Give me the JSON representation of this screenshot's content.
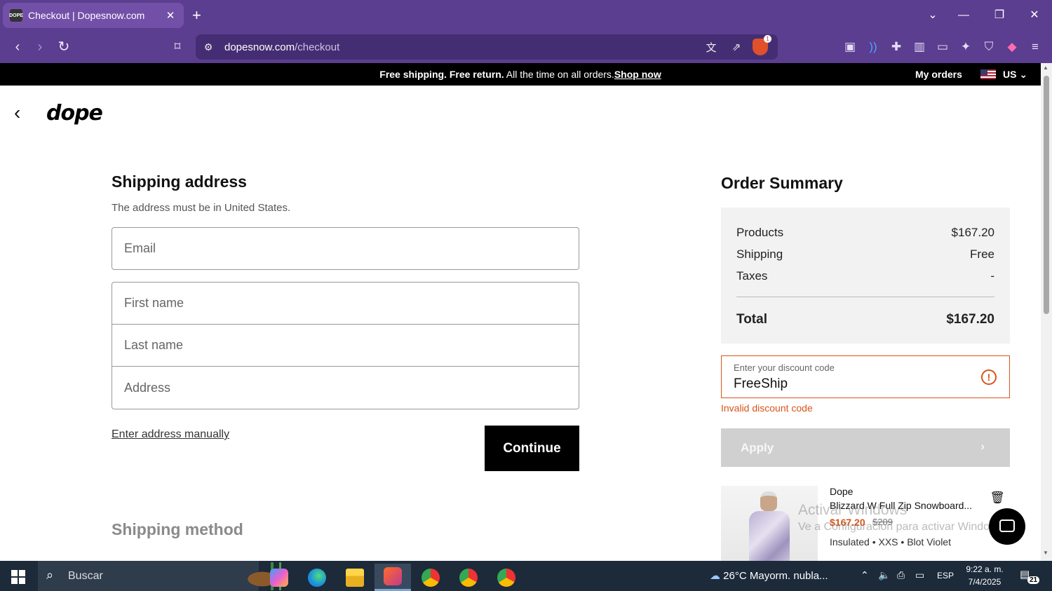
{
  "browser": {
    "tab_title": "Checkout | Dopesnow.com",
    "tab_favicon": "DOPE",
    "url_domain": "dopesnow.com",
    "url_path": "/checkout"
  },
  "promo": {
    "text": "Free shipping. Free return.",
    "text_rest": " All the time on all orders.",
    "link": "Shop now",
    "my_orders": "My orders",
    "country": "US"
  },
  "header": {
    "logo": "dope"
  },
  "shipping": {
    "title": "Shipping address",
    "subtitle": "The address must be in United States.",
    "email_placeholder": "Email",
    "first_name_placeholder": "First name",
    "last_name_placeholder": "Last name",
    "address_placeholder": "Address",
    "manual_link": "Enter address manually",
    "continue_label": "Continue",
    "method_title": "Shipping method"
  },
  "summary": {
    "title": "Order Summary",
    "products_label": "Products",
    "products_value": "$167.20",
    "shipping_label": "Shipping",
    "shipping_value": "Free",
    "taxes_label": "Taxes",
    "taxes_value": "-",
    "total_label": "Total",
    "total_value": "$167.20"
  },
  "discount": {
    "label": "Enter your discount code",
    "value": "FreeShip",
    "error": "Invalid discount code",
    "apply_label": "Apply"
  },
  "product": {
    "brand": "Dope",
    "name": "Blizzard W Full Zip Snowboard...",
    "price": "$167.20",
    "old_price": "$209",
    "variant": "Insulated • XXS • Blot Violet"
  },
  "watermark": {
    "line1": "Activar Windows",
    "line2": "Ve a Configuración para activar Windows."
  },
  "taskbar": {
    "search_text": "Buscar",
    "weather": "26°C  Mayorm. nubla...",
    "lang": "ESP",
    "time": "9:22 a. m.",
    "date": "7/4/2025",
    "notifications": "21"
  },
  "colors": {
    "browser_chrome": "#5b3e8f",
    "error": "#d8541a",
    "primary_button": "#000000"
  }
}
